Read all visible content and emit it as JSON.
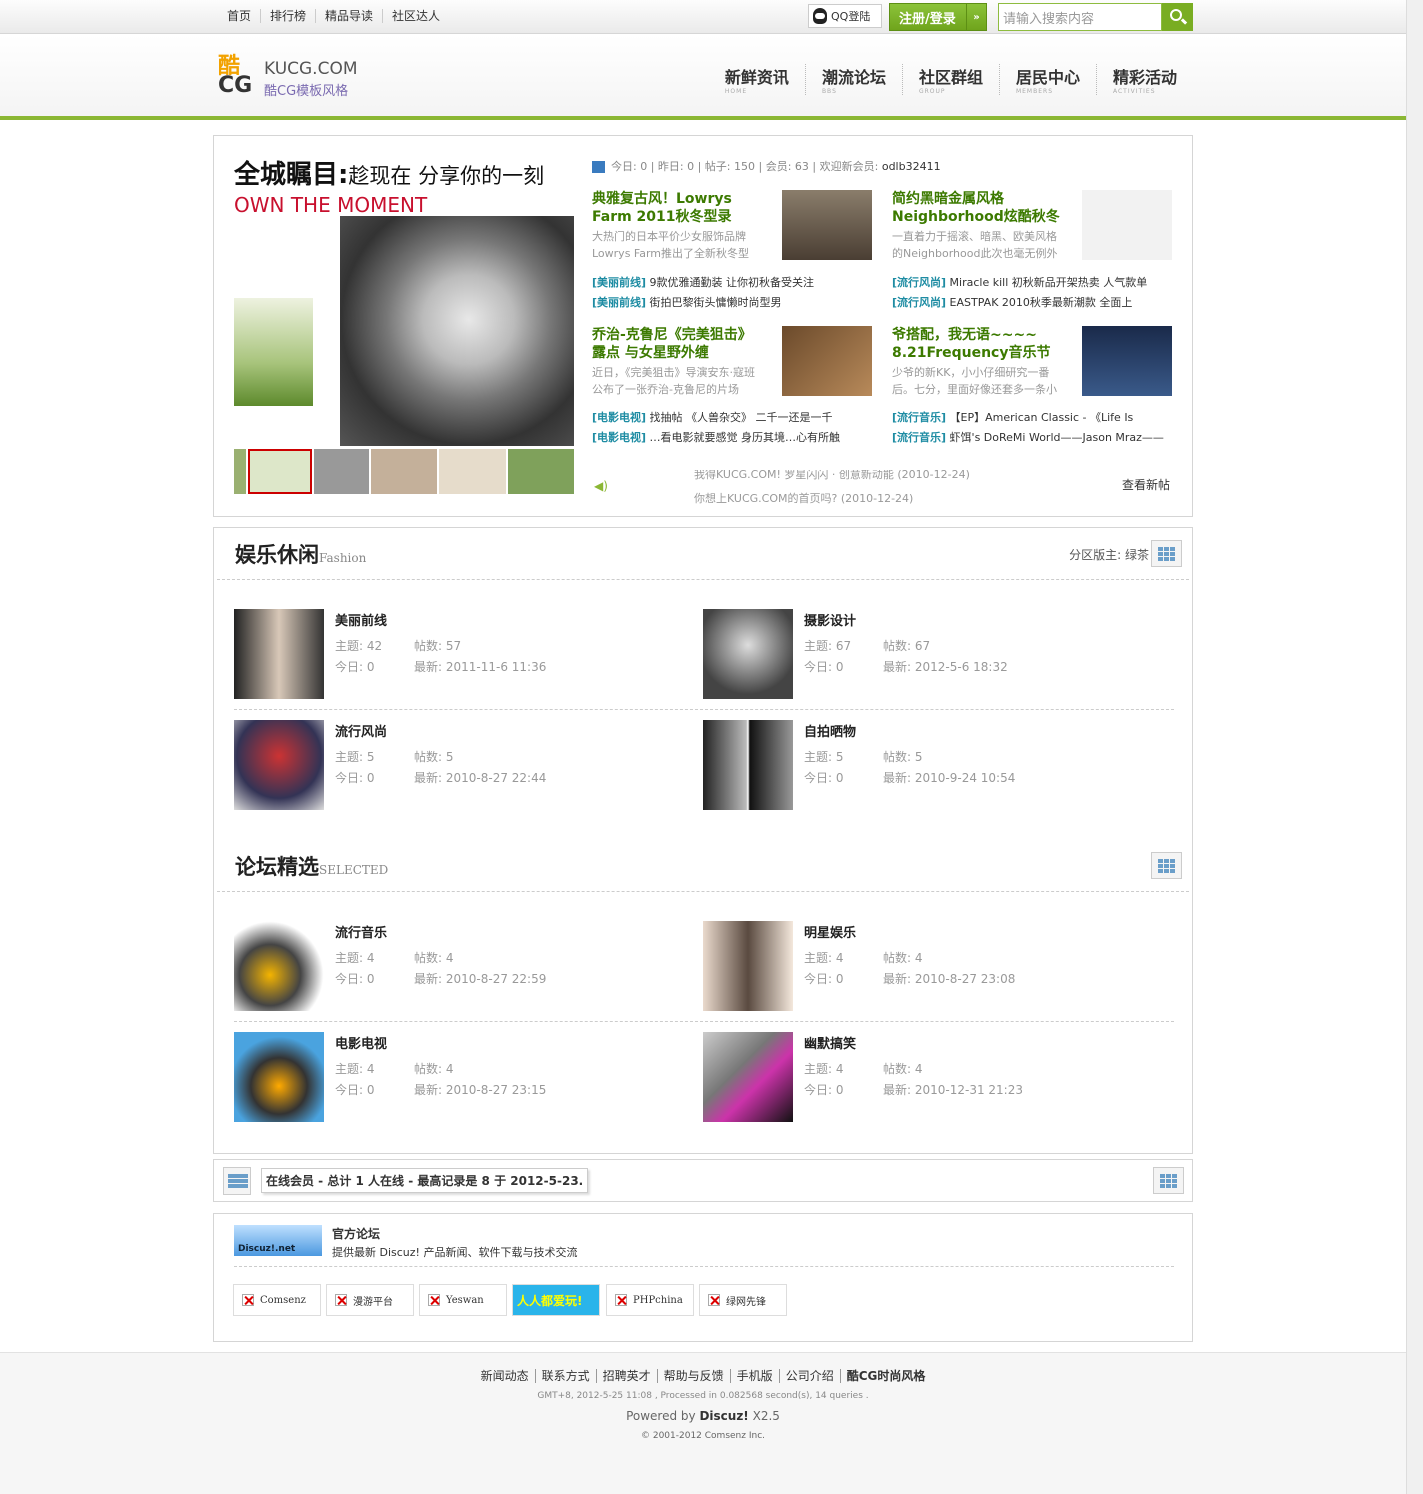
{
  "topnav": [
    "首页",
    "排行榜",
    "精品导读",
    "社区达人"
  ],
  "qq_login": "QQ登陆",
  "register": "注册/登录",
  "search_placeholder": "请输入搜索内容",
  "logo": {
    "mark_top": "酷",
    "mark_bottom": "CG",
    "site": "KUCG.COM",
    "sub": "酷CG模板风格"
  },
  "mainnav": [
    {
      "t": "新鲜资讯",
      "s": "HOME"
    },
    {
      "t": "潮流论坛",
      "s": "BBS"
    },
    {
      "t": "社区群组",
      "s": "GROUP"
    },
    {
      "t": "居民中心",
      "s": "MEMBERS"
    },
    {
      "t": "精彩活动",
      "s": "ACTIVITIES"
    }
  ],
  "slide": {
    "h1": "全城瞩目:",
    "h1b": "趁现在 分享你的一刻",
    "h2": "OWN THE MOMENT"
  },
  "stats": {
    "today": "今日: 0",
    "yest": "昨日: 0",
    "posts": "帖子: 150",
    "members": "会员: 63",
    "newmem_label": "欢迎新会员:",
    "newmem": "odlb32411"
  },
  "feat": [
    {
      "t": "典雅复古风！Lowrys Farm 2011秋冬型录",
      "d": "大热门的日本平价少女服饰品牌Lowrys Farm推出了全新秋冬型"
    },
    {
      "t": "简约黑暗金属风格 Neighborhood炫酷秋冬",
      "d": "一直着力于摇滚、暗黑、欧美风格的Neighborhood此次也毫无例外"
    },
    {
      "t": "乔治-克鲁尼《完美狙击》露点 与女星野外缠",
      "d": "近日，《完美狙击》导演安东·寇班公布了一张乔治-克鲁尼的片场"
    },
    {
      "t": "爷搭配，我无语~~~~ 8.21Frequency音乐节",
      "d": "少爷的新KK，小小仔细研究一番后。七分，里面好像还套多一条小"
    }
  ],
  "links": [
    {
      "c": "[美丽前线]",
      "t": " 9款优雅通勤装 让你初秋备受关注"
    },
    {
      "c": "[流行风尚]",
      "t": " Miracle kill 初秋新品开架热卖 人气款单"
    },
    {
      "c": "[美丽前线]",
      "t": " 街拍巴黎街头慵懒时尚型男"
    },
    {
      "c": "[流行风尚]",
      "t": " EASTPAK 2010秋季最新潮款 全面上"
    },
    {
      "c": "[电影电视]",
      "t": " 找抽帖 《人兽杂交》 二千一还是一千"
    },
    {
      "c": "[流行音乐]",
      "t": " 【EP】American Classic - 《Life Is"
    },
    {
      "c": "[电影电视]",
      "t": " …看电影就要感觉 身历其境…心有所触"
    },
    {
      "c": "[流行音乐]",
      "t": " 虾饵's DoReMi World——Jason Mraz——"
    }
  ],
  "notice": [
    "我得KUCG.COM! 罗星闪闪 · 创意新动能 (2010-12-24)",
    "你想上KUCG.COM的首页吗? (2010-12-24)"
  ],
  "view_new": "查看新帖",
  "sec1": {
    "title": "娱乐休闲",
    "en": "Fashion",
    "mod": "分区版主: 绿茶"
  },
  "sec2": {
    "title": "论坛精选",
    "en": "SELECTED"
  },
  "forums1": [
    {
      "n": "美丽前线",
      "a": "主题: 42",
      "b": "帖数: 57",
      "c": "今日: 0",
      "d": "最新: 2011-11-6 11:36"
    },
    {
      "n": "摄影设计",
      "a": "主题: 67",
      "b": "帖数: 67",
      "c": "今日: 0",
      "d": "最新: 2012-5-6 18:32"
    },
    {
      "n": "流行风尚",
      "a": "主题: 5",
      "b": "帖数: 5",
      "c": "今日: 0",
      "d": "最新: 2010-8-27 22:44"
    },
    {
      "n": "自拍晒物",
      "a": "主题: 5",
      "b": "帖数: 5",
      "c": "今日: 0",
      "d": "最新: 2010-9-24 10:54"
    }
  ],
  "forums2": [
    {
      "n": "流行音乐",
      "a": "主题: 4",
      "b": "帖数: 4",
      "c": "今日: 0",
      "d": "最新: 2010-8-27 22:59"
    },
    {
      "n": "明星娱乐",
      "a": "主题: 4",
      "b": "帖数: 4",
      "c": "今日: 0",
      "d": "最新: 2010-8-27 23:08"
    },
    {
      "n": "电影电视",
      "a": "主题: 4",
      "b": "帖数: 4",
      "c": "今日: 0",
      "d": "最新: 2010-8-27 23:15"
    },
    {
      "n": "幽默搞笑",
      "a": "主题: 4",
      "b": "帖数: 4",
      "c": "今日: 0",
      "d": "最新: 2010-12-31 21:23"
    }
  ],
  "online": "在线会员 - 总计 1 人在线 - 最高记录是 8 于 2012-5-23.",
  "official": {
    "badge": "Discuz!.net",
    "t": "官方论坛",
    "d": "提供最新 Discuz! 产品新闻、软件下载与技术交流"
  },
  "friendlinks": [
    "Comsenz",
    "漫游平台",
    "Yeswan",
    "人人都爱玩!",
    "PHPchina",
    "绿网先锋"
  ],
  "footer": {
    "links": [
      "新闻动态",
      "联系方式",
      "招聘英才",
      "帮助与反馈",
      "手机版",
      "公司介绍",
      "酷CG时尚风格"
    ],
    "stat": "GMT+8, 2012-5-25 11:08 , Processed in 0.082568 second(s), 14 queries .",
    "powered": "Powered by",
    "brand": "Discuz!",
    "ver": " X2.5",
    "copy": "© 2001-2012 Comsenz Inc."
  }
}
